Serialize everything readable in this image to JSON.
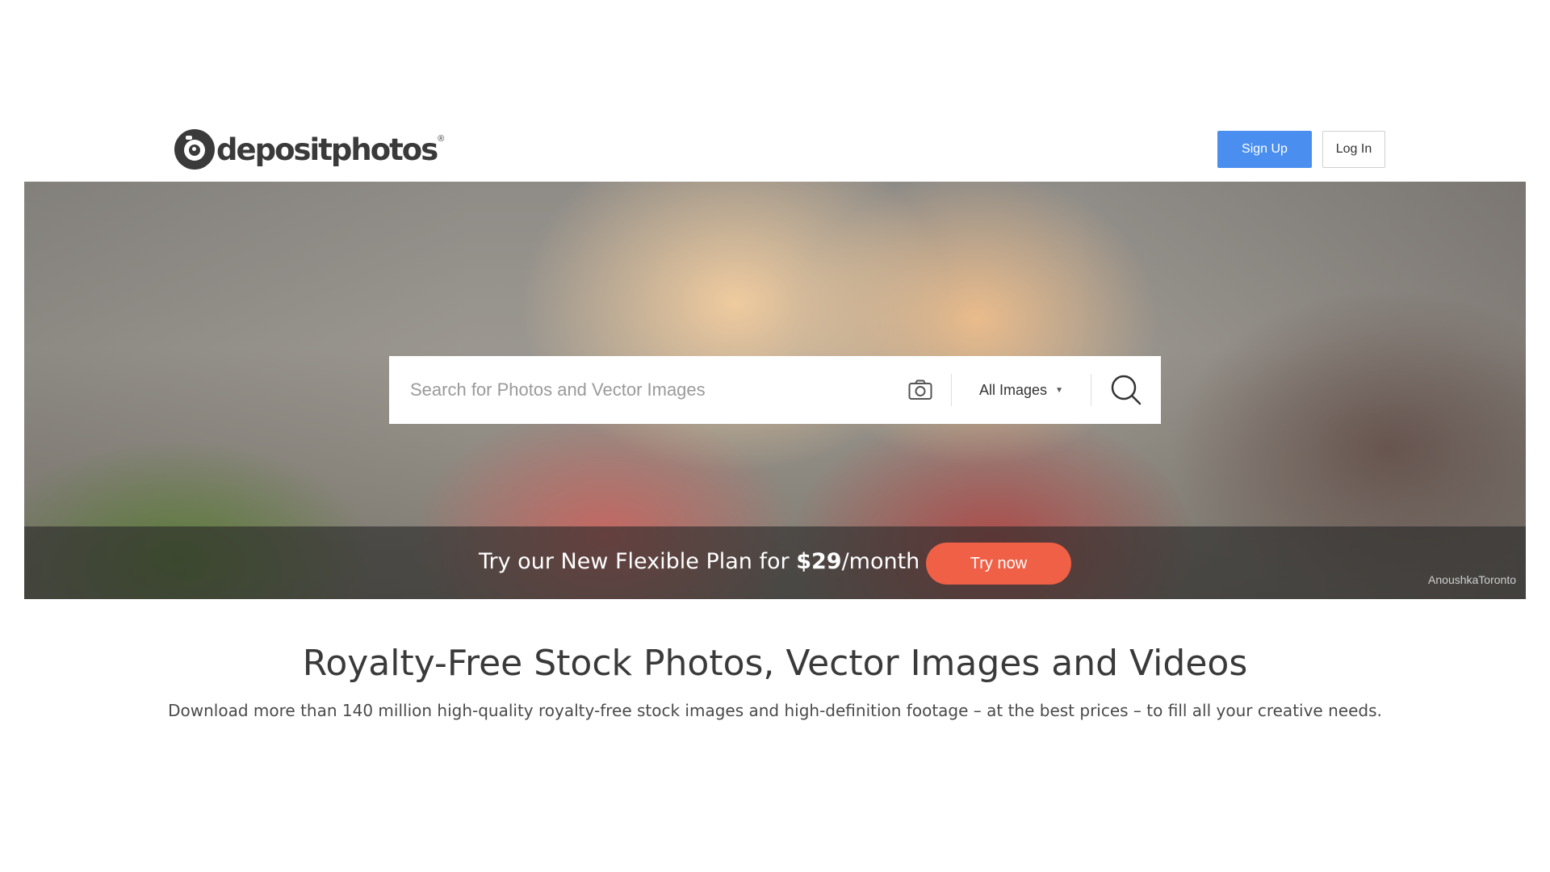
{
  "header": {
    "logo_text": "depositphotos",
    "logo_reg": "®",
    "signup_label": "Sign Up",
    "login_label": "Log In"
  },
  "hero": {
    "search": {
      "placeholder": "Search for Photos and Vector Images",
      "value": "",
      "filter_label": "All Images"
    },
    "promo": {
      "text_before": "Try our New Flexible Plan for ",
      "price": "$29",
      "text_after": "/month",
      "cta_label": "Try now"
    },
    "credit": "AnoushkaToronto"
  },
  "main": {
    "headline": "Royalty-Free Stock Photos, Vector Images and Videos",
    "subline": "Download more than 140 million high-quality royalty-free stock images and high-definition footage – at the best prices – to fill all your creative needs."
  },
  "icons": {
    "logo": "camera-logo-icon",
    "visual_search": "camera-icon",
    "dropdown": "caret-down-icon",
    "search": "search-icon"
  },
  "colors": {
    "signup_button": "#4a8ff0",
    "try_button": "#ef6046",
    "text_dark": "#3a3a3a"
  }
}
